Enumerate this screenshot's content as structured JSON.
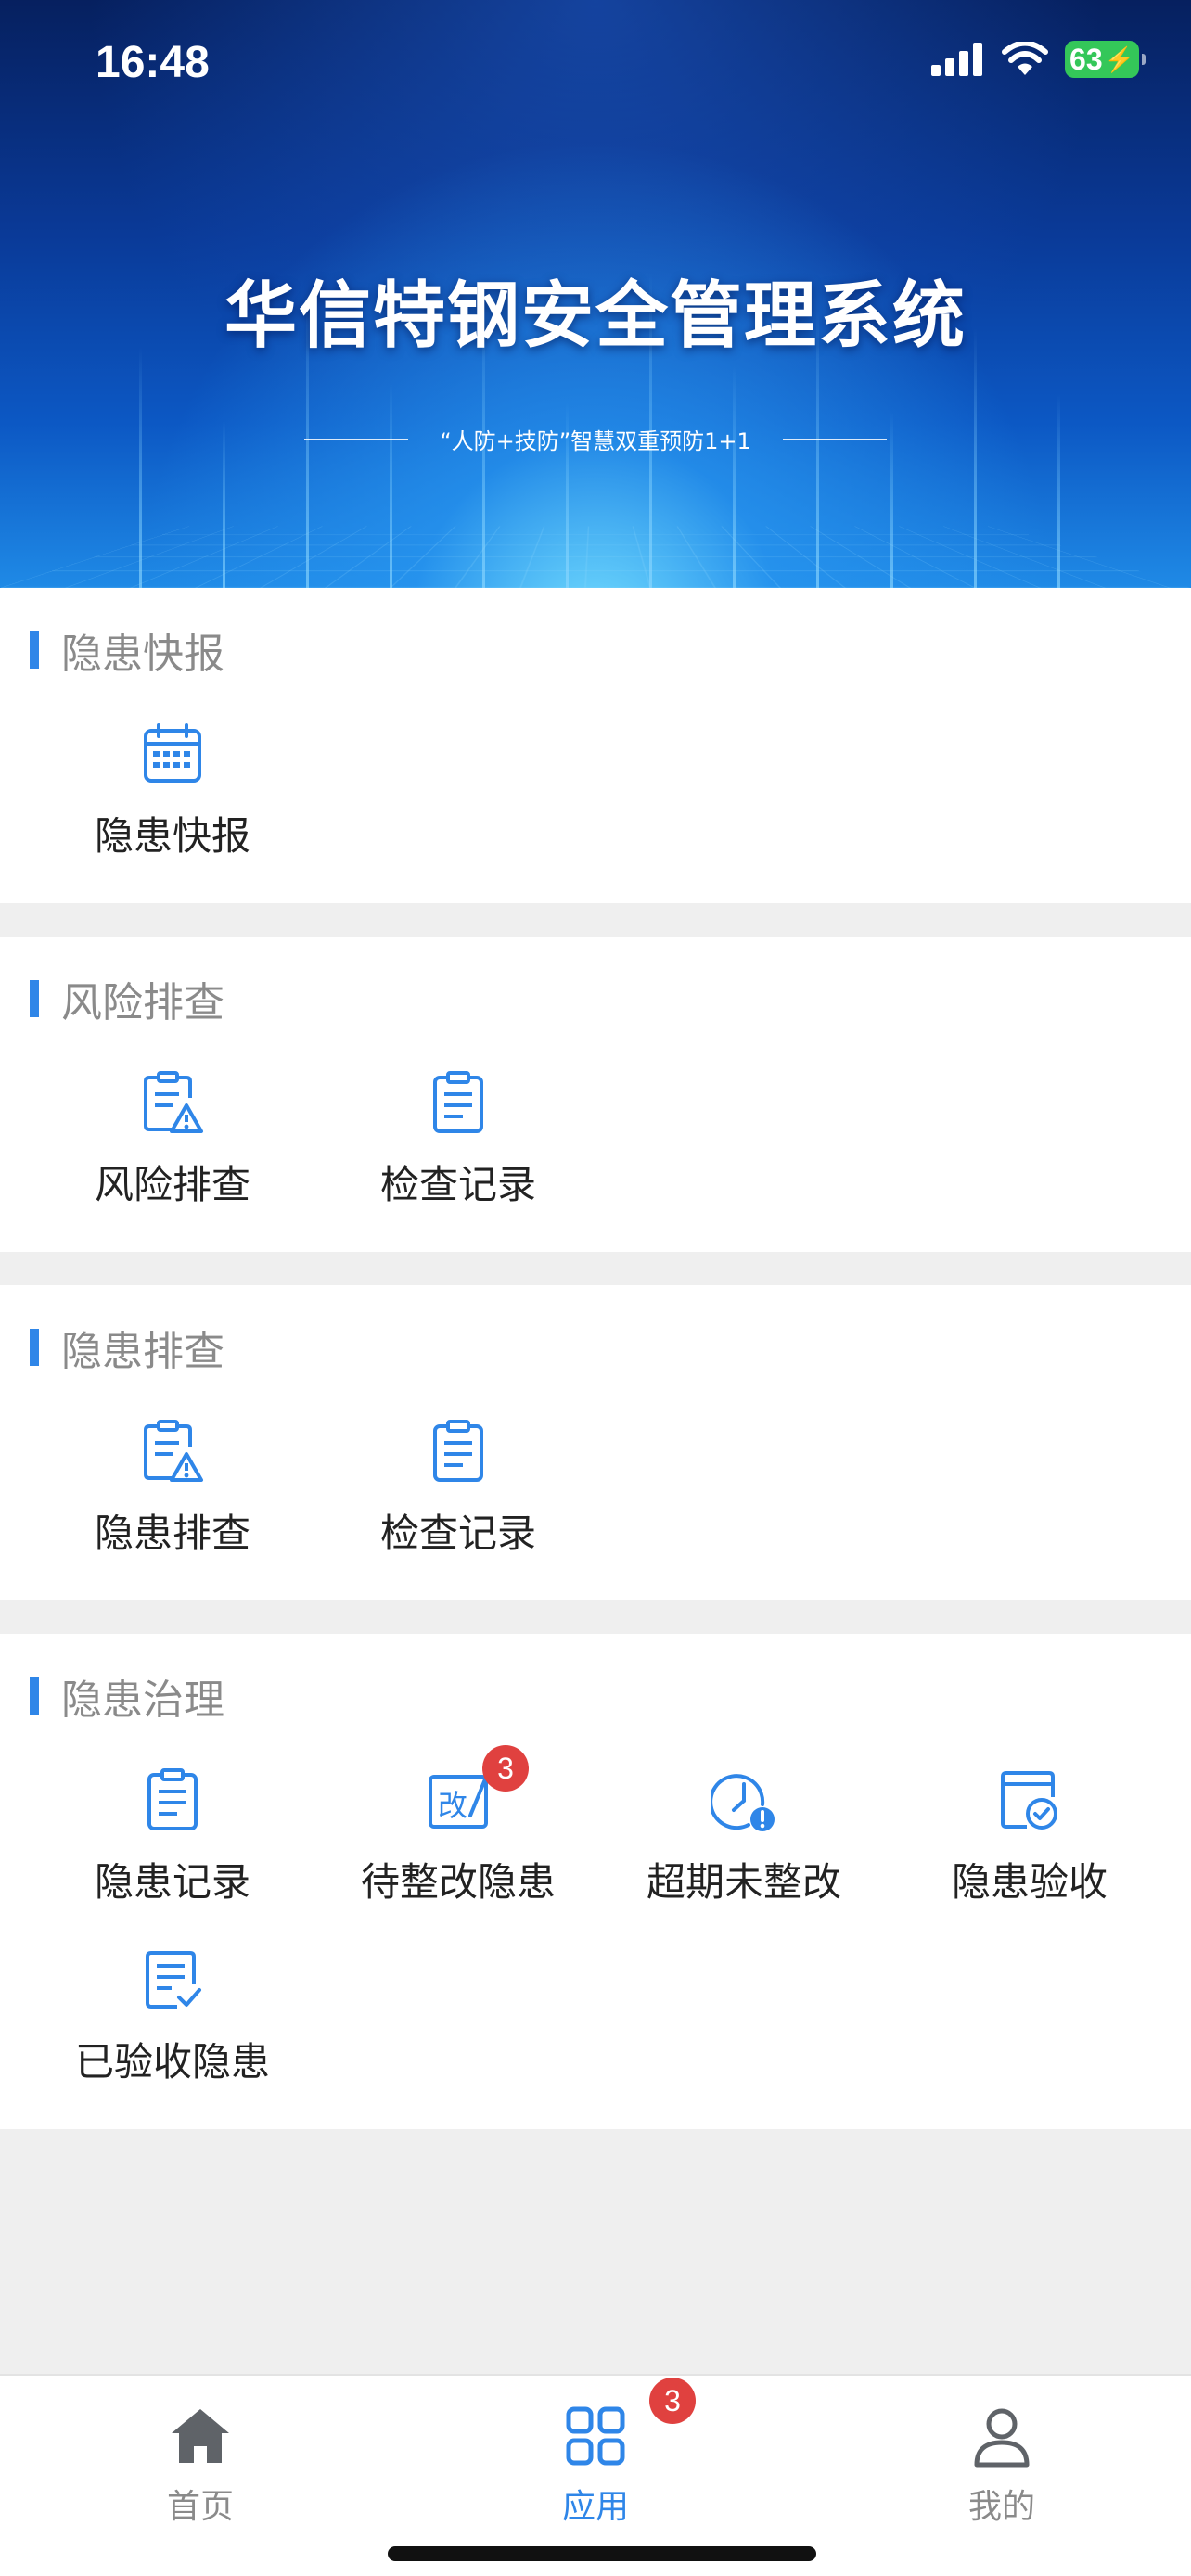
{
  "status_bar": {
    "time": "16:48",
    "battery": "63"
  },
  "banner": {
    "title": "华信特钢安全管理系统",
    "subtitle": "“人防+技防”智慧双重预防1+1"
  },
  "sections": [
    {
      "title": "隐患快报",
      "items": [
        {
          "label": "隐患快报",
          "icon": "calendar-icon"
        }
      ]
    },
    {
      "title": "风险排查",
      "items": [
        {
          "label": "风险排查",
          "icon": "checklist-warning-icon"
        },
        {
          "label": "检查记录",
          "icon": "clipboard-icon"
        }
      ]
    },
    {
      "title": "隐患排查",
      "items": [
        {
          "label": "隐患排查",
          "icon": "checklist-warning-icon"
        },
        {
          "label": "检查记录",
          "icon": "clipboard-icon"
        }
      ]
    },
    {
      "title": "隐患治理",
      "items": [
        {
          "label": "隐患记录",
          "icon": "clipboard-icon"
        },
        {
          "label": "待整改隐患",
          "icon": "rectify-icon",
          "badge": "3"
        },
        {
          "label": "超期未整改",
          "icon": "overdue-clock-icon"
        },
        {
          "label": "隐患验收",
          "icon": "acceptance-icon"
        },
        {
          "label": "已验收隐患",
          "icon": "document-check-icon"
        }
      ]
    }
  ],
  "tabbar": {
    "tabs": [
      {
        "label": "首页",
        "icon": "home-icon"
      },
      {
        "label": "应用",
        "icon": "apps-grid-icon",
        "badge": "3",
        "active": true
      },
      {
        "label": "我的",
        "icon": "user-icon"
      }
    ]
  },
  "colors": {
    "accent": "#2f86e8",
    "badge": "#e0413f",
    "battery": "#34c759",
    "muted": "#8a8a8a"
  }
}
